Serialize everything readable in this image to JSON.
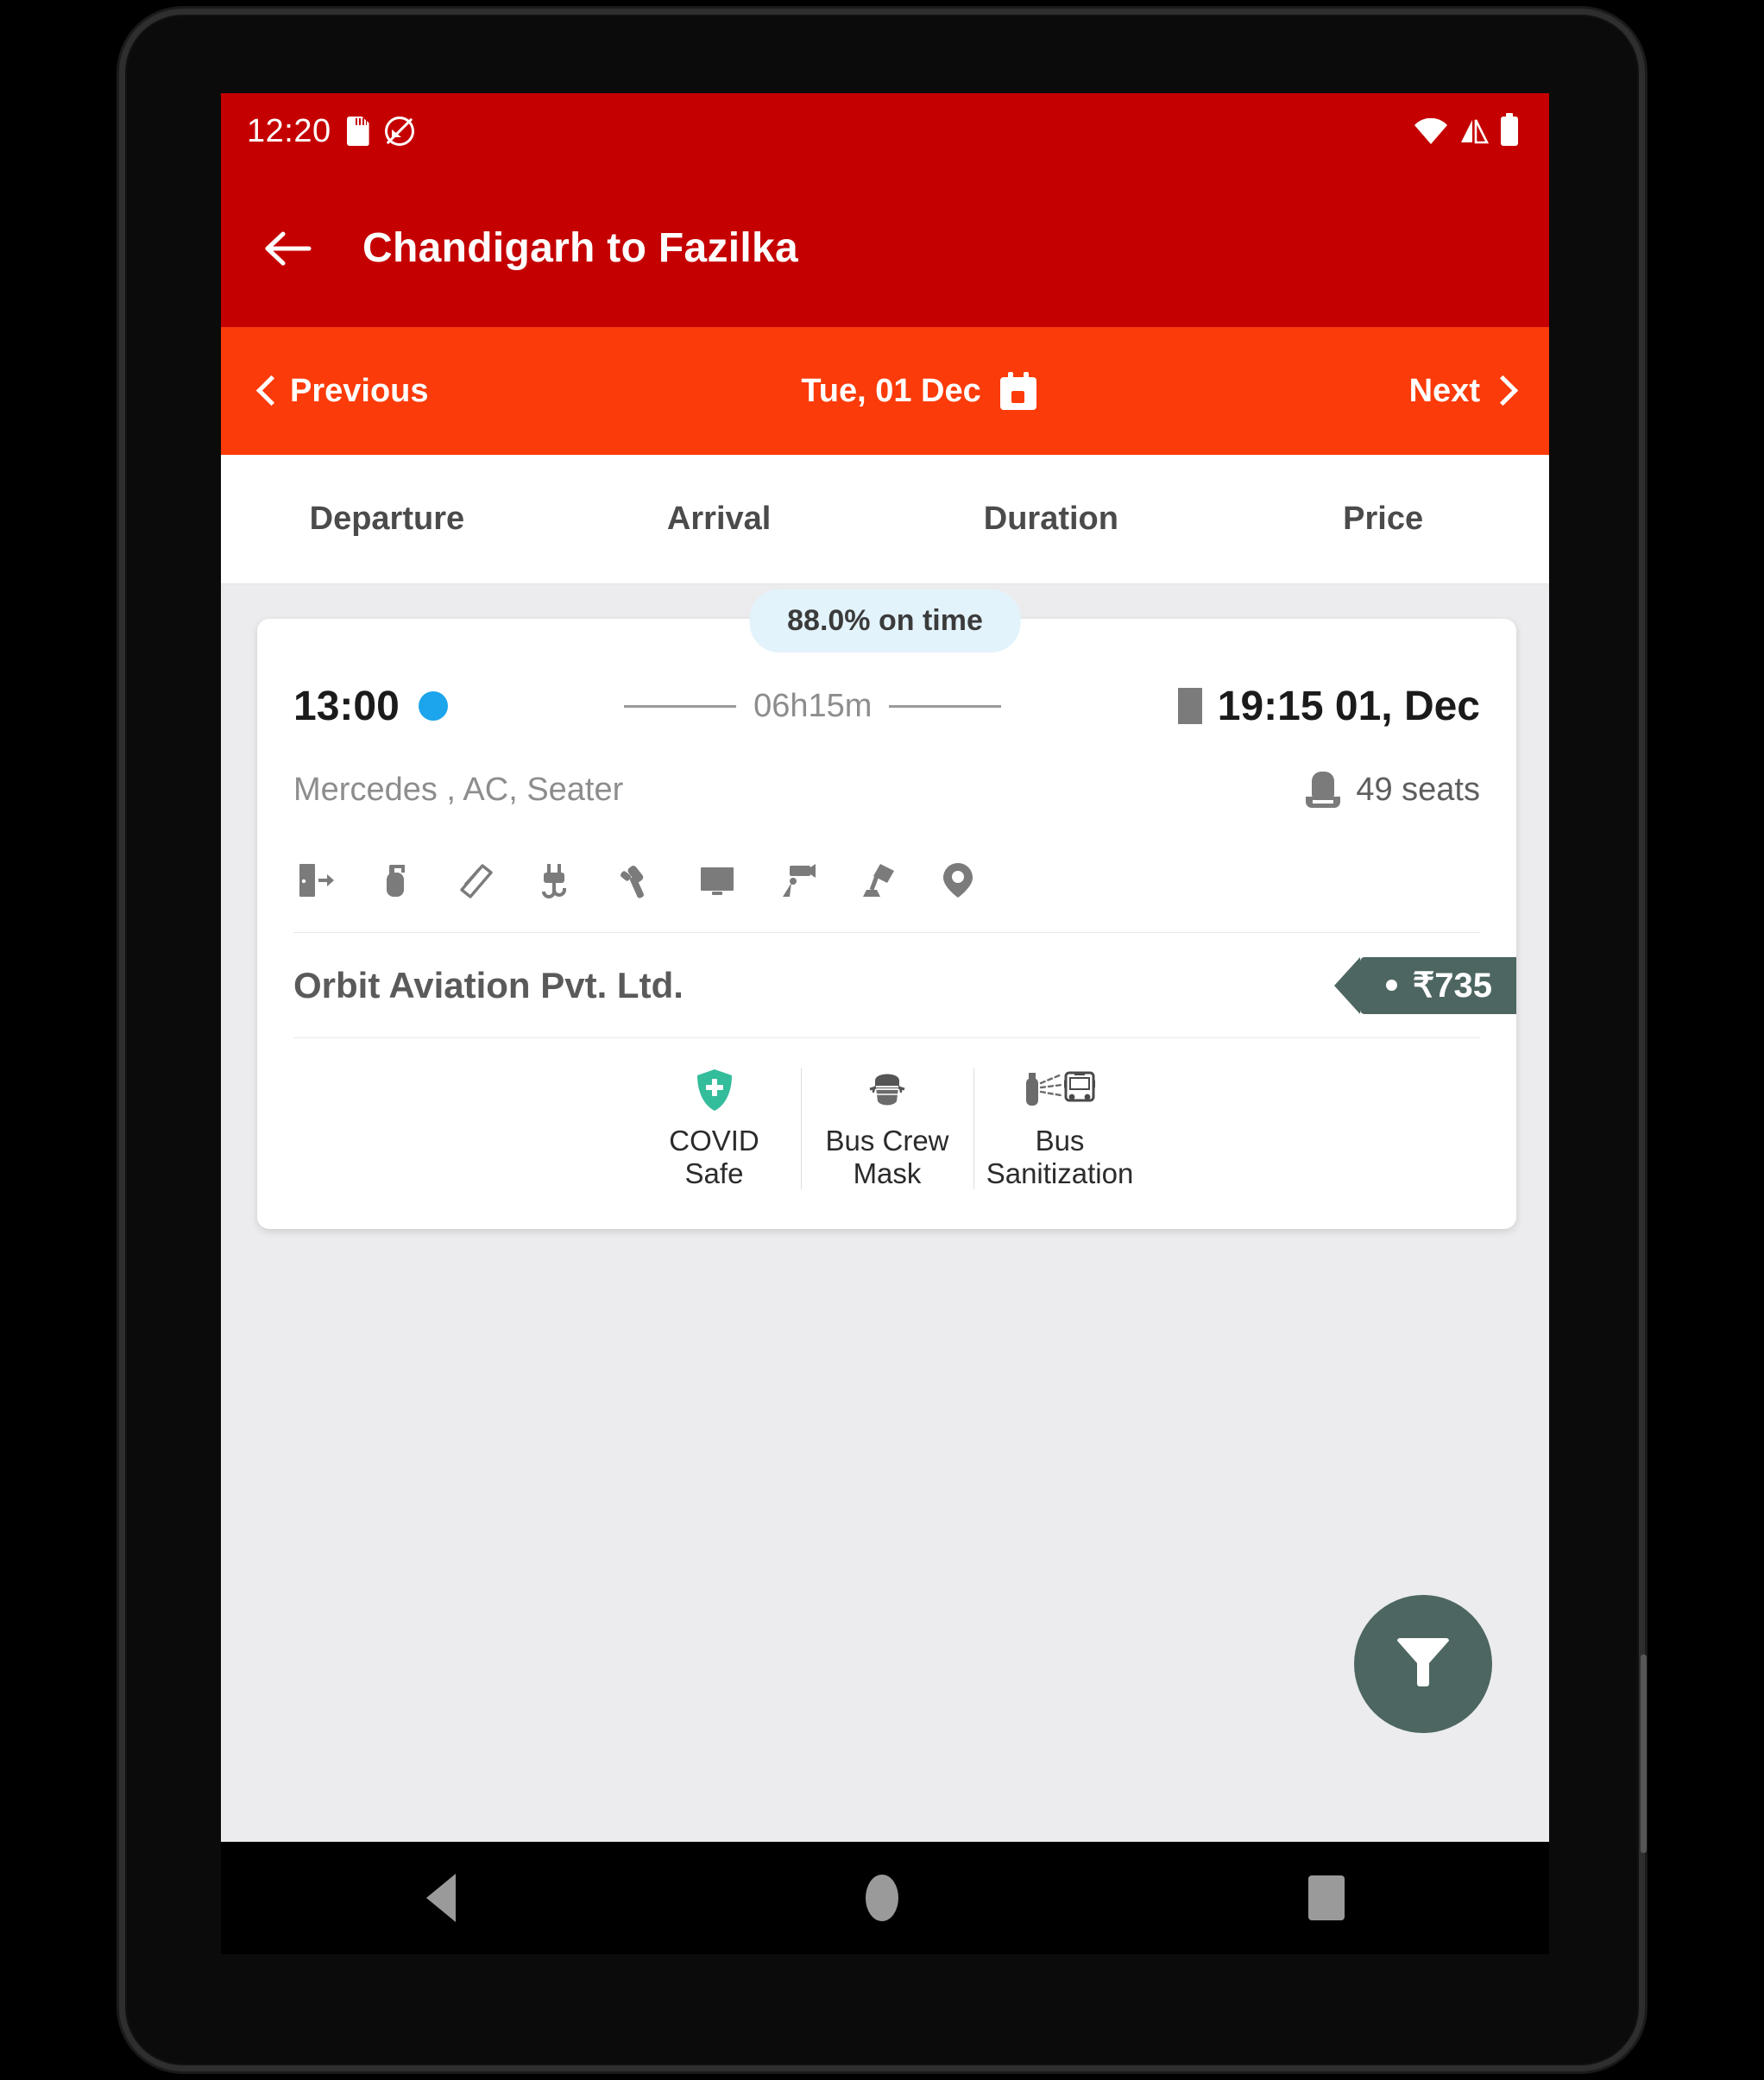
{
  "status_bar": {
    "time": "12:20",
    "icons_left": [
      "sd-card-icon",
      "auto-rotate-off-icon"
    ],
    "icons_right": [
      "wifi-icon",
      "signal-icon",
      "battery-icon"
    ]
  },
  "app_bar": {
    "back_icon": "back-arrow-icon",
    "title": "Chandigarh to Fazilka",
    "bg_color": "#C50000"
  },
  "date_bar": {
    "previous_label": "Previous",
    "date_label": "Tue, 01 Dec",
    "next_label": "Next",
    "calendar_icon": "calendar-icon",
    "bg_color": "#FB3B09"
  },
  "sort_tabs": [
    {
      "label": "Departure"
    },
    {
      "label": "Arrival"
    },
    {
      "label": "Duration"
    },
    {
      "label": "Price"
    }
  ],
  "bus_card": {
    "on_time_badge": "88.0% on time",
    "departure_time": "13:00",
    "duration": "06h15m",
    "arrival_time": "19:15 01, Dec",
    "bus_type": "Mercedes , AC, Seater",
    "seats": "49 seats",
    "amenities": [
      "emergency-exit-icon",
      "fire-extinguisher-icon",
      "hammer-icon",
      "charging-point-icon",
      "emergency-hammer-icon",
      "tv-icon",
      "cctv-camera-icon",
      "reading-light-icon",
      "live-tracking-icon"
    ],
    "operator": "Orbit Aviation Pvt. Ltd.",
    "price": "₹735",
    "price_color": "#4D6661",
    "covid_items": [
      {
        "icon": "covid-shield-icon",
        "label": "COVID\nSafe"
      },
      {
        "icon": "face-mask-icon",
        "label": "Bus Crew\nMask"
      },
      {
        "icon": "bus-sanitization-icon",
        "label": "Bus\nSanitization"
      }
    ]
  },
  "filter_fab": {
    "icon": "filter-funnel-icon",
    "color": "#4D6661"
  },
  "nav_bar": {
    "back": "nav-back-icon",
    "home": "nav-home-icon",
    "recents": "nav-recents-icon"
  }
}
